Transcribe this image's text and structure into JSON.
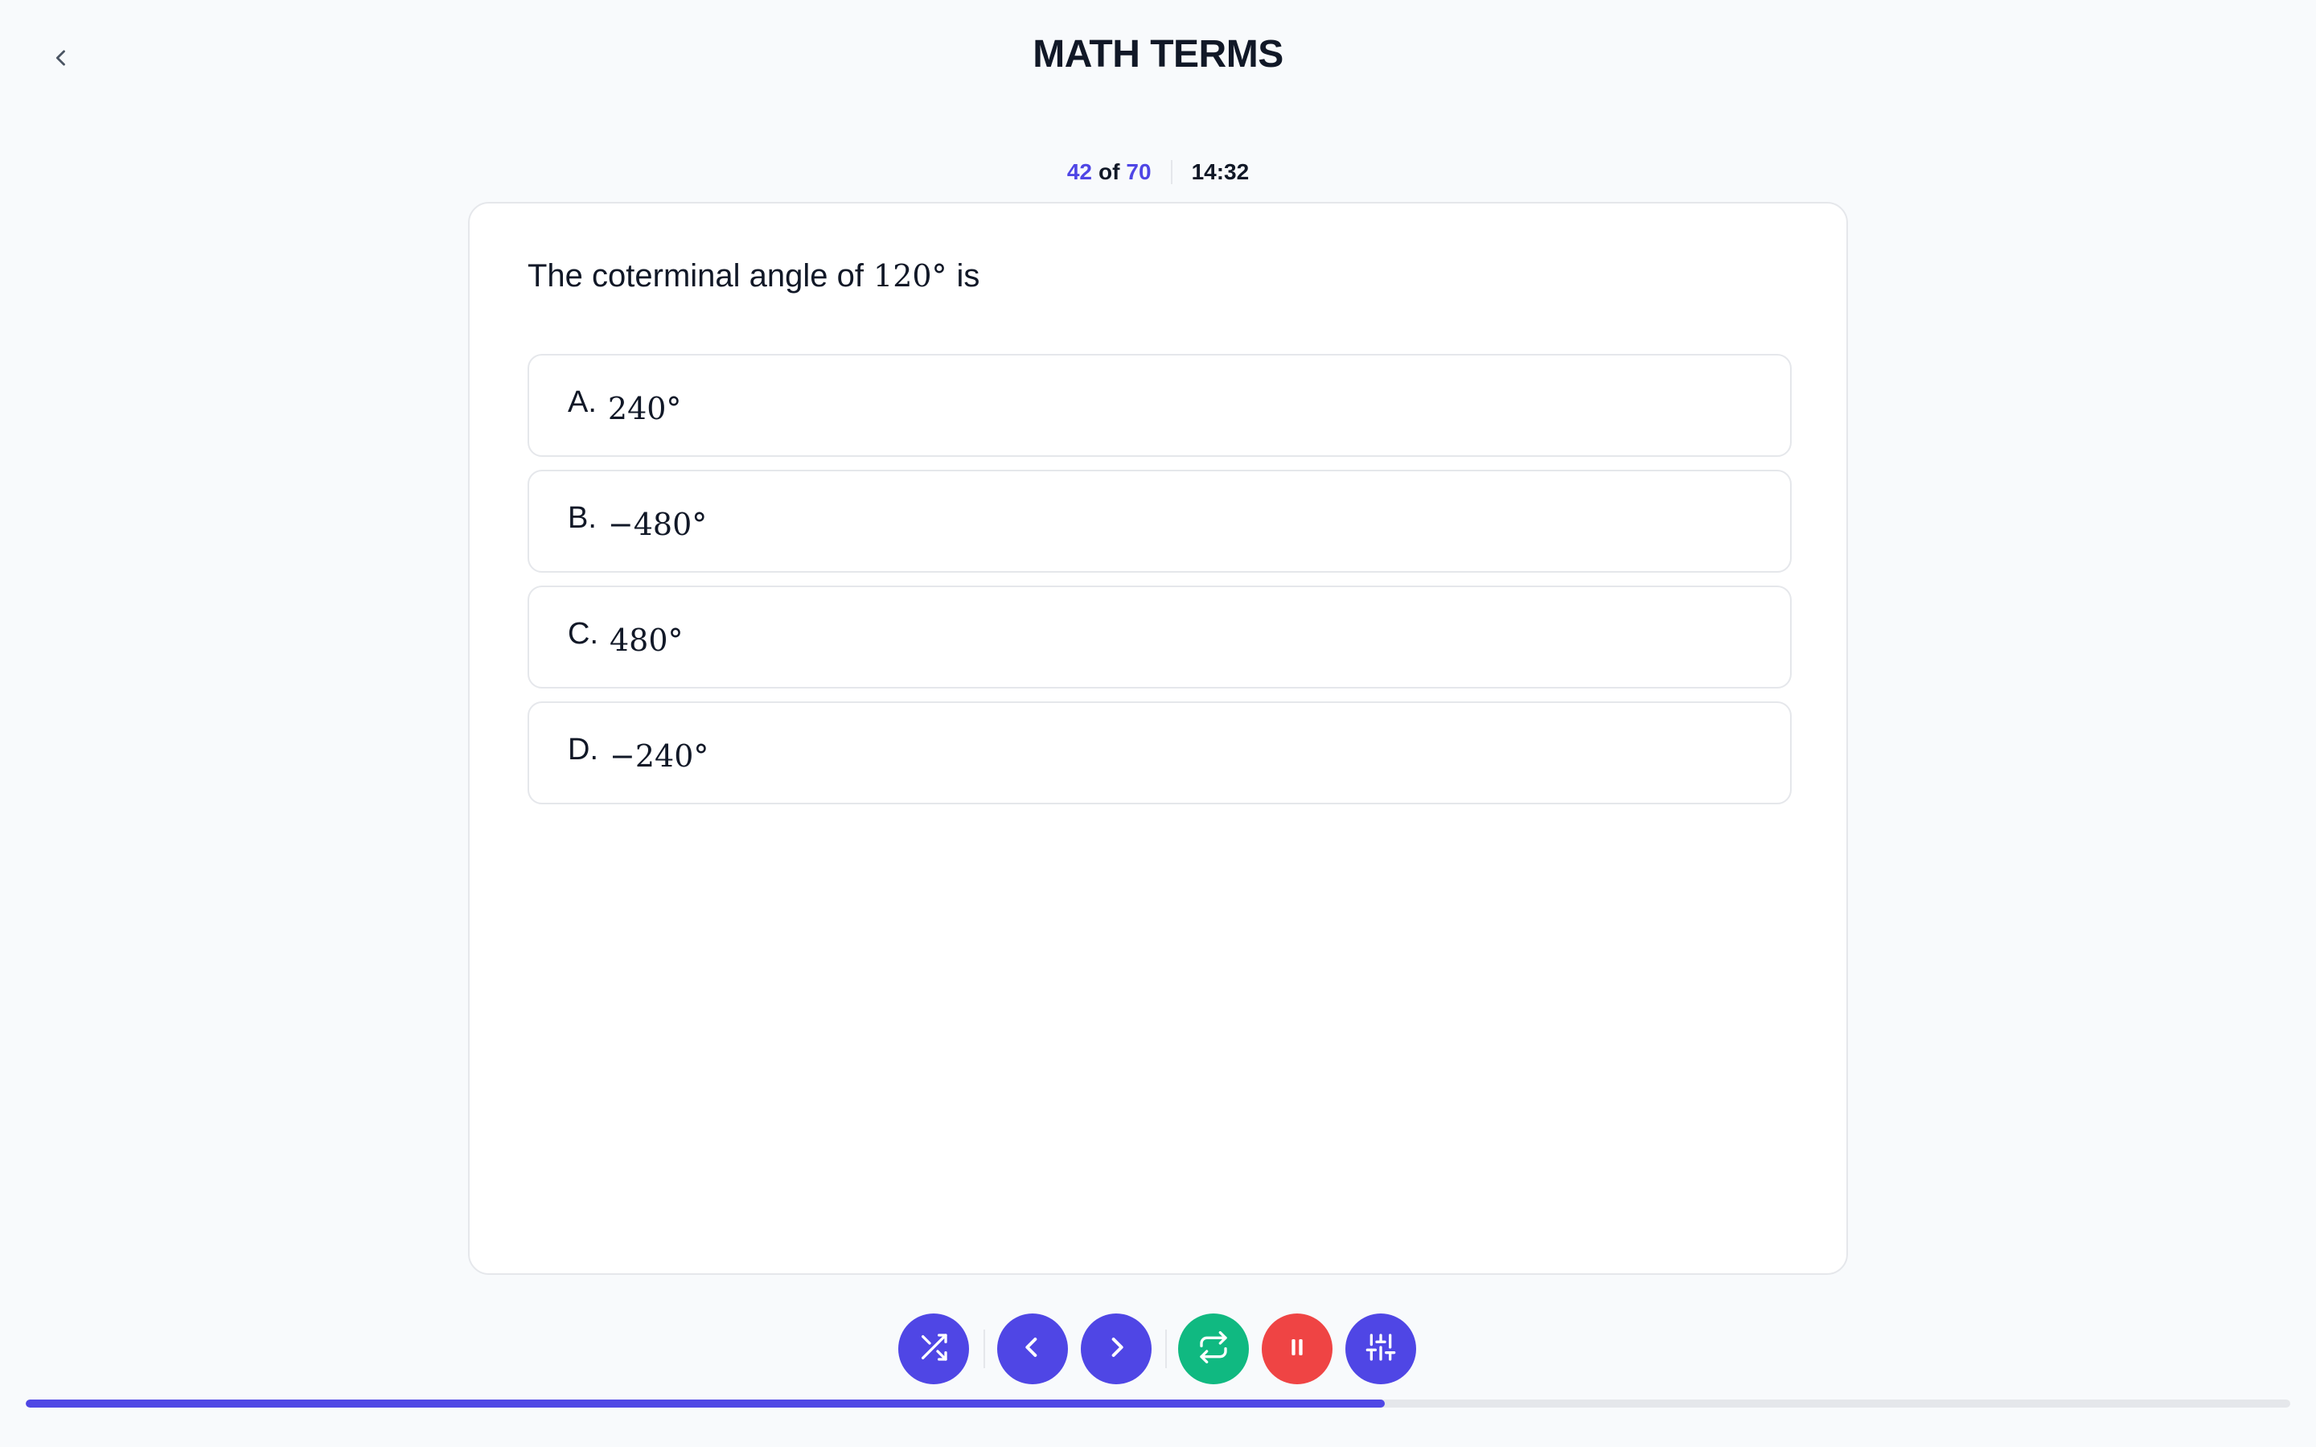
{
  "header": {
    "title": "MATH TERMS",
    "back_icon": "chevron-left-icon"
  },
  "status": {
    "current": "42",
    "of_label": "of",
    "total": "70",
    "timer": "14:32"
  },
  "question": {
    "prefix": "The coterminal angle of",
    "math": "120°",
    "suffix": "is"
  },
  "options": [
    {
      "letter": "A.",
      "value": "240°"
    },
    {
      "letter": "B.",
      "value": "−480°"
    },
    {
      "letter": "C.",
      "value": "480°"
    },
    {
      "letter": "D.",
      "value": "−240°"
    }
  ],
  "controls": [
    {
      "name": "shuffle-button",
      "icon": "shuffle-icon",
      "color": "#4f46e5"
    },
    {
      "name": "previous-button",
      "icon": "chevron-left-icon",
      "color": "#4f46e5"
    },
    {
      "name": "next-button",
      "icon": "chevron-right-icon",
      "color": "#4f46e5"
    },
    {
      "name": "repeat-button",
      "icon": "repeat-icon",
      "color": "#10b981"
    },
    {
      "name": "pause-button",
      "icon": "pause-icon",
      "color": "#ef4444"
    },
    {
      "name": "settings-button",
      "icon": "sliders-icon",
      "color": "#4f46e5"
    }
  ],
  "progress": {
    "fraction": 0.6,
    "fill_color": "#4f46e5",
    "track_color": "#e5e7eb"
  }
}
